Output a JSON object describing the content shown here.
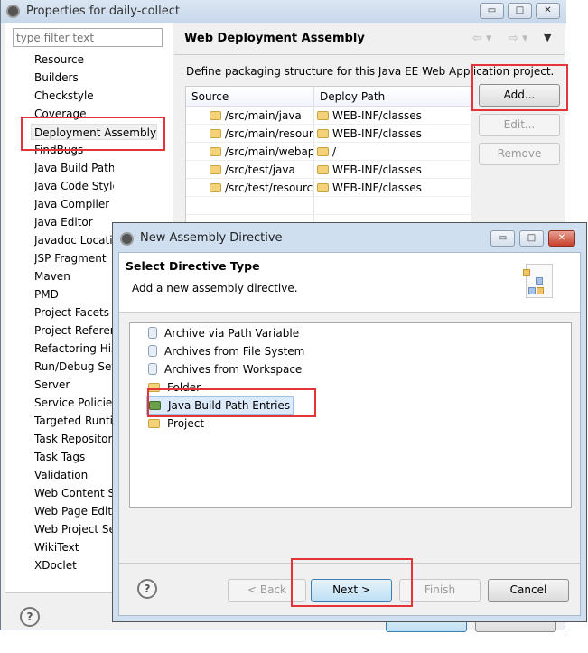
{
  "window": {
    "title": "Properties for daily-collect",
    "min": "▭",
    "max": "□",
    "close": "✕"
  },
  "filter": {
    "placeholder": "type filter text"
  },
  "nav": [
    "Resource",
    "Builders",
    "Checkstyle",
    "Coverage",
    "Deployment Assembly",
    "FindBugs",
    "Java Build Path",
    "Java Code Style",
    "Java Compiler",
    "Java Editor",
    "Javadoc Location",
    "JSP Fragment",
    "Maven",
    "PMD",
    "Project Facets",
    "Project References",
    "Refactoring History",
    "Run/Debug Settings",
    "Server",
    "Service Policies",
    "Targeted Runtimes",
    "Task Repository",
    "Task Tags",
    "Validation",
    "Web Content Settings",
    "Web Page Editor",
    "Web Project Settings",
    "WikiText",
    "XDoclet"
  ],
  "page": {
    "title": "Web Deployment Assembly",
    "description": "Define packaging structure for this Java EE Web Application project.",
    "columns": [
      "Source",
      "Deploy Path"
    ],
    "rows": [
      [
        "/src/main/java",
        "WEB-INF/classes"
      ],
      [
        "/src/main/resources",
        "WEB-INF/classes"
      ],
      [
        "/src/main/webapp",
        "/"
      ],
      [
        "/src/test/java",
        "WEB-INF/classes"
      ],
      [
        "/src/test/resources",
        "WEB-INF/classes"
      ]
    ],
    "buttons": {
      "add": "Add...",
      "edit": "Edit...",
      "remove": "Remove"
    }
  },
  "dialog": {
    "title": "New Assembly Directive",
    "heading": "Select Directive Type",
    "subtitle": "Add a new assembly directive.",
    "items": [
      "Archive via Path Variable",
      "Archives from File System",
      "Archives from Workspace",
      "Folder",
      "Java Build Path Entries",
      "Project"
    ],
    "selected": "Java Build Path Entries",
    "buttons": {
      "back": "< Back",
      "next": "Next >",
      "finish": "Finish",
      "cancel": "Cancel"
    }
  },
  "help": "?",
  "colors": {
    "highlight_box": "#e3343a",
    "selection": "#dcebfc"
  }
}
